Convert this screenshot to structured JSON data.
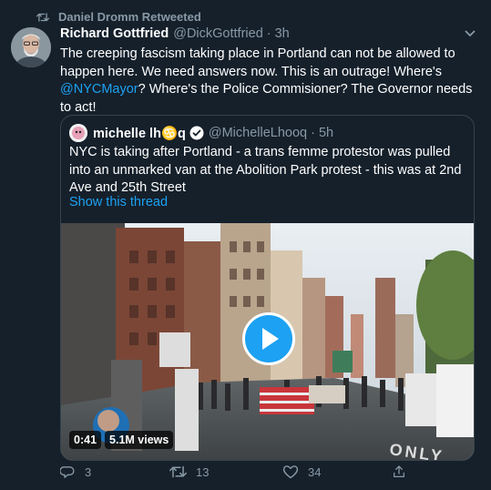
{
  "retweet": {
    "label": "Daniel Dromm Retweeted",
    "icon": "retweet-icon"
  },
  "tweet": {
    "author_name": "Richard Gottfried",
    "handle": "@DickGottfried",
    "separator": "·",
    "time": "3h",
    "text_part1": "The creeping fascism taking place in Portland can not be allowed to happen here. We need answers now. This is an outrage! Where's ",
    "mention": "@NYCMayor",
    "text_part2": "? Where's the Police Commisioner? The Governor needs to act!"
  },
  "quote": {
    "author_name": "michelle lh♋q",
    "handle": "@MichelleLhooq",
    "separator": "·",
    "time": "5h",
    "verified": true,
    "text": "NYC is taking after Portland - a trans femme protestor was pulled into an unmarked van at the Abolition Park protest - this was at 2nd Ave and 25th Street",
    "thread_link": "Show this thread",
    "video": {
      "duration": "0:41",
      "views": "5.1M views",
      "street_text": "ONLY"
    }
  },
  "actions": {
    "replies": "3",
    "retweets": "13",
    "likes": "34"
  },
  "colors": {
    "background": "#15202b",
    "accent": "#1da1f2",
    "muted": "#8899a6",
    "border": "#38444d"
  }
}
